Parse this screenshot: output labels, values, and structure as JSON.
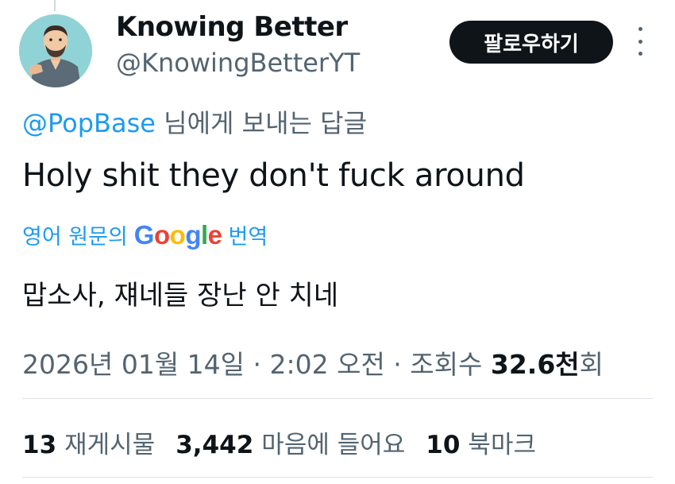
{
  "user": {
    "display_name": "Knowing Better",
    "handle": "@KnowingBetterYT",
    "avatar_icon": "cartoon-man-avatar"
  },
  "follow_button": {
    "label": "팔로우하기"
  },
  "more_icon": "vertical-ellipsis-icon",
  "reply_to": {
    "mention": "@PopBase",
    "suffix": " 님에게 보내는 답글"
  },
  "tweet": {
    "text": "Holy shit they don't fuck around"
  },
  "translation": {
    "prefix": "영어 원문의",
    "brand": "Google",
    "suffix": "번역",
    "text": "맙소사, 쟤네들 장난 안 치네"
  },
  "meta": {
    "timestamp": "2026년 01월 14일 · 2:02 오전 · 조회수 ",
    "views_number": "32.6천",
    "views_suffix": "회"
  },
  "stats": {
    "reposts_count": "13",
    "reposts_label": "재게시물",
    "likes_count": "3,442",
    "likes_label": "마음에 들어요",
    "bookmarks_count": "10",
    "bookmarks_label": "북마크"
  },
  "colors": {
    "link_blue": "#1d9bf0",
    "text_primary": "#0f1419",
    "text_secondary": "#536471",
    "avatar_bg": "#8fd3d6",
    "button_bg": "#0f1419",
    "google_blue": "#4285F4",
    "google_red": "#EA4335",
    "google_yellow": "#FBBC05",
    "google_green": "#34A853"
  }
}
